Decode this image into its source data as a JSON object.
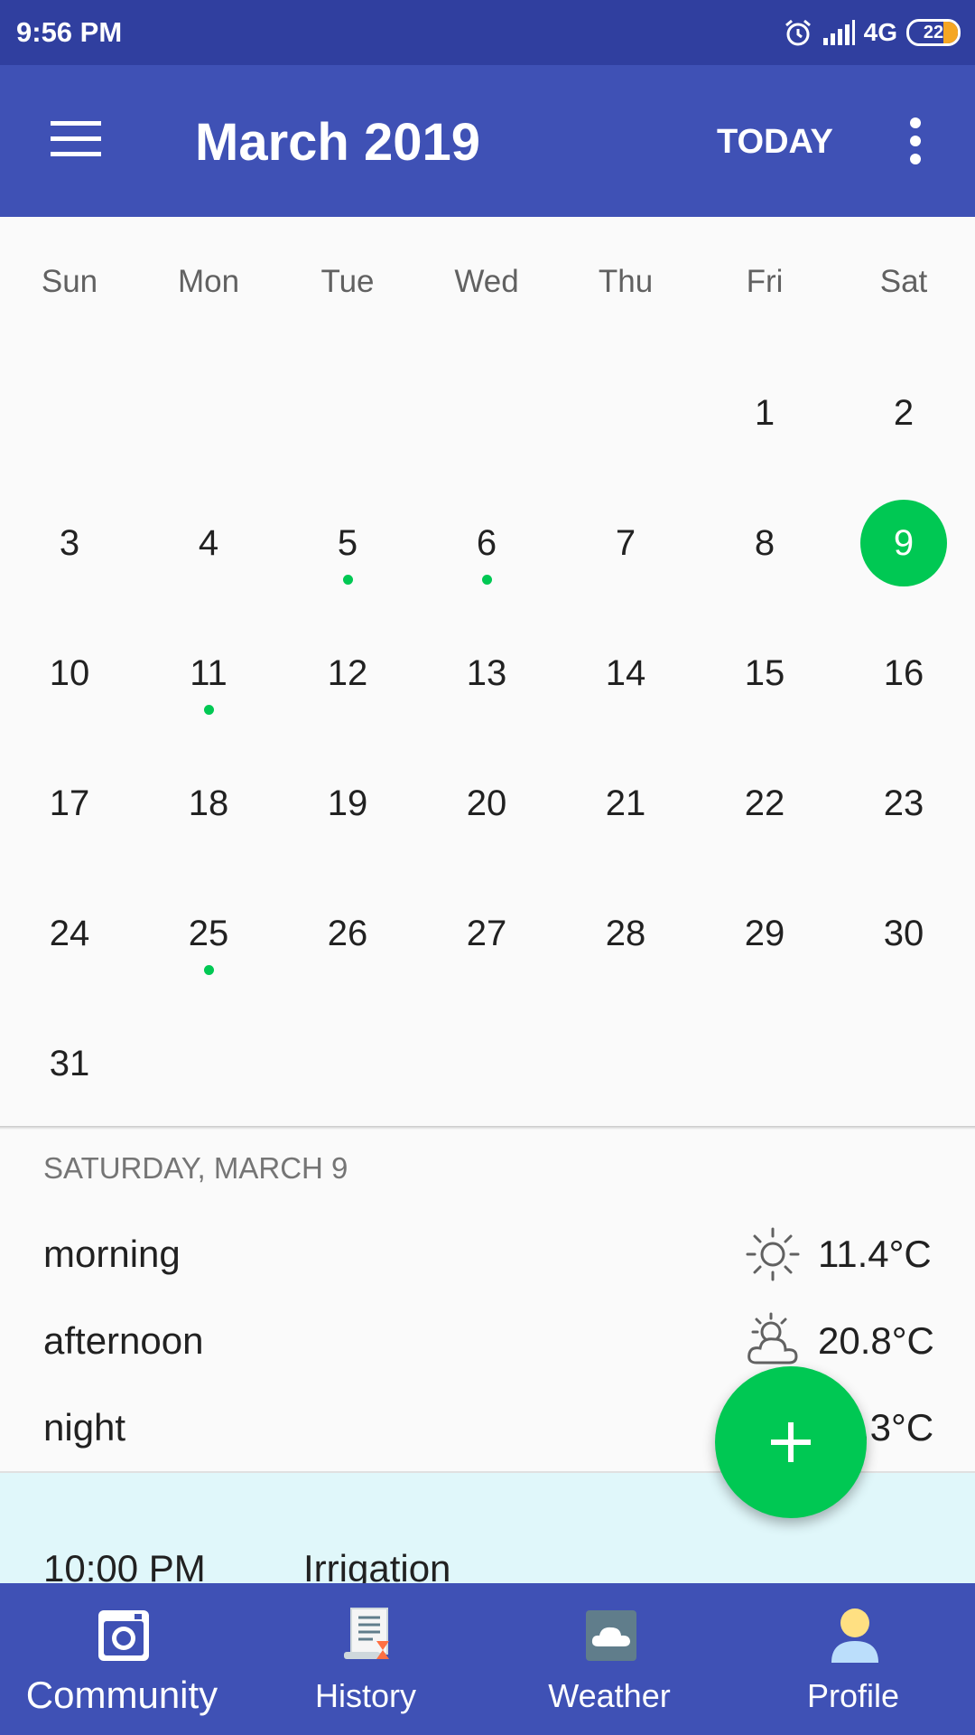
{
  "status_bar": {
    "time": "9:56 PM",
    "network": "4G",
    "battery": "22",
    "icons": [
      "alarm-icon",
      "signal-icon",
      "battery-icon"
    ]
  },
  "app_bar": {
    "title": "March 2019",
    "today_label": "TODAY",
    "icons": [
      "menu-icon",
      "more-vert-icon"
    ],
    "color": "#3f51b5"
  },
  "calendar": {
    "weekdays": [
      "Sun",
      "Mon",
      "Tue",
      "Wed",
      "Thu",
      "Fri",
      "Sat"
    ],
    "weeks": [
      [
        "",
        "",
        "",
        "",
        "",
        "1",
        "2"
      ],
      [
        "3",
        "4",
        "5",
        "6",
        "7",
        "8",
        "9"
      ],
      [
        "10",
        "11",
        "12",
        "13",
        "14",
        "15",
        "16"
      ],
      [
        "17",
        "18",
        "19",
        "20",
        "21",
        "22",
        "23"
      ],
      [
        "24",
        "25",
        "26",
        "27",
        "28",
        "29",
        "30"
      ],
      [
        "31",
        "",
        "",
        "",
        "",
        "",
        ""
      ]
    ],
    "selected_day": "9",
    "event_days": [
      "5",
      "6",
      "11",
      "25"
    ],
    "accent_color": "#00c853"
  },
  "day_detail": {
    "header": "SATURDAY, MARCH 9",
    "forecast": [
      {
        "label": "morning",
        "temp": "11.4°C",
        "icon": "sun-icon"
      },
      {
        "label": "afternoon",
        "temp": "20.8°C",
        "icon": "partly-cloudy-icon"
      },
      {
        "label": "night",
        "temp": ".3°C",
        "icon": ""
      }
    ],
    "event": {
      "time": "10:00 PM",
      "title": "Irrigation"
    }
  },
  "fab": {
    "icon": "plus-icon"
  },
  "bottom_nav": {
    "items": [
      {
        "label": "Community",
        "icon": "camera-icon"
      },
      {
        "label": "History",
        "icon": "history-scroll-icon"
      },
      {
        "label": "Weather",
        "icon": "cloud-icon"
      },
      {
        "label": "Profile",
        "icon": "person-icon"
      }
    ]
  }
}
